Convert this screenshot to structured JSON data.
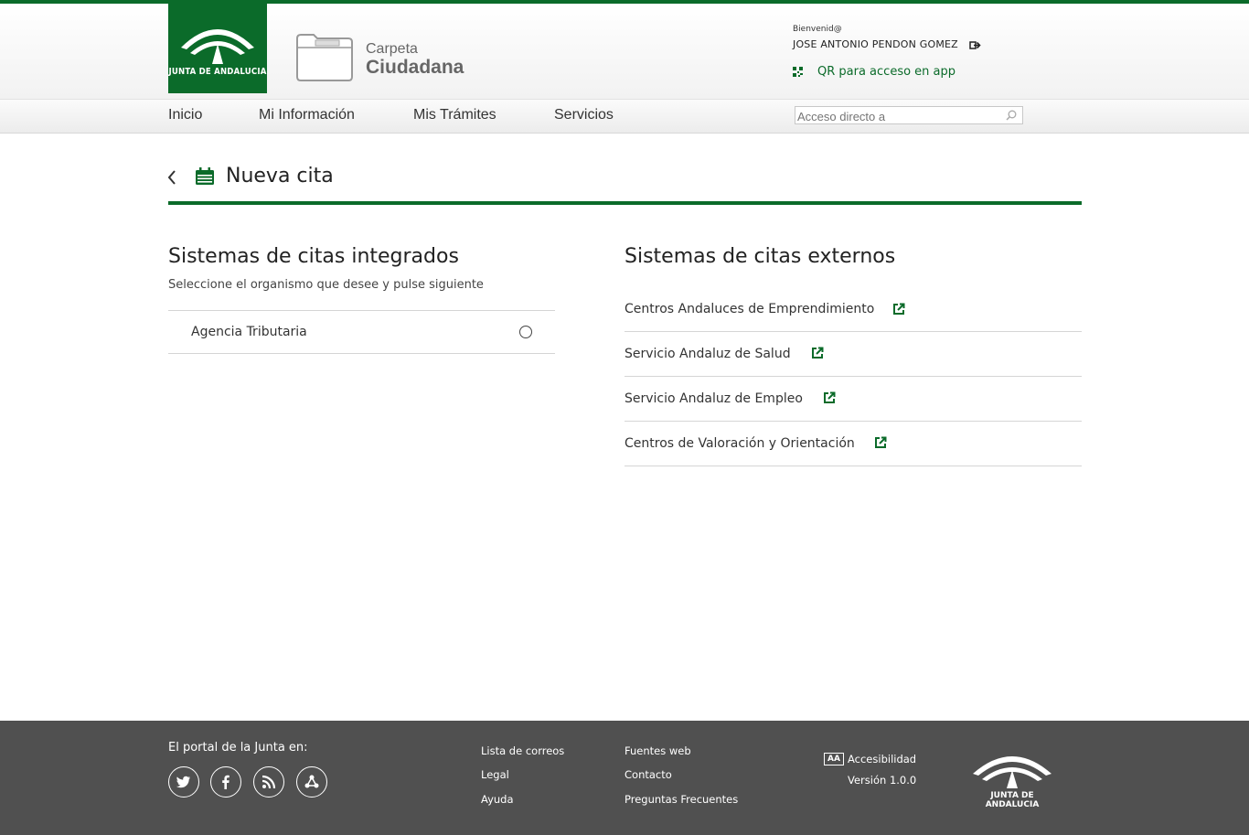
{
  "header": {
    "logo_text": "JUNTA DE ANDALUCIA",
    "app_title_line1": "Carpeta",
    "app_title_line2": "Ciudadana",
    "welcome": "Bienvenid@",
    "username": "JOSE ANTONIO PENDON GOMEZ",
    "qr_link": "QR para acceso en app"
  },
  "nav": {
    "items": [
      "Inicio",
      "Mi Información",
      "Mis Trámites",
      "Servicios"
    ],
    "search_placeholder": "Acceso directo a"
  },
  "page": {
    "title": "Nueva cita"
  },
  "integrated": {
    "heading": "Sistemas de citas integrados",
    "subtitle": "Seleccione el organismo que desee y pulse siguiente",
    "options": [
      "Agencia Tributaria"
    ]
  },
  "external": {
    "heading": "Sistemas de citas externos",
    "links": [
      "Centros Andaluces de Emprendimiento",
      "Servicio Andaluz de Salud",
      "Servicio Andaluz de Empleo",
      "Centros de Valoración y Orientación"
    ]
  },
  "footer": {
    "portal_label": "El portal de la Junta en:",
    "social": [
      "twitter-icon",
      "facebook-icon",
      "rss-icon",
      "share-network-icon"
    ],
    "col1": [
      "Lista de correos",
      "Legal",
      "Ayuda"
    ],
    "col2": [
      "Fuentes web",
      "Contacto",
      "Preguntas Frecuentes"
    ],
    "aa_badge": "AA",
    "accessibility": "Accesibilidad",
    "version": "Versión 1.0.0",
    "logo_text": "JUNTA DE ANDALUCIA"
  },
  "colors": {
    "brand_green": "#0b6b2a",
    "footer_bg": "#505050"
  }
}
